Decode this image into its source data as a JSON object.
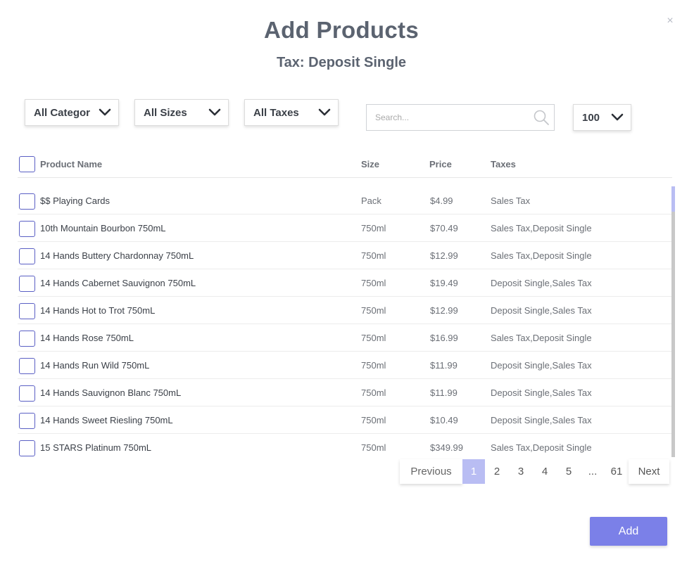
{
  "modal": {
    "title": "Add Products",
    "subtitle": "Tax: Deposit Single",
    "close_label": "×"
  },
  "filters": {
    "category": "All Categor",
    "sizes": "All Sizes",
    "taxes": "All Taxes",
    "page_size": "100"
  },
  "search": {
    "placeholder": "Search...",
    "value": ""
  },
  "table": {
    "headers": {
      "name": "Product Name",
      "size": "Size",
      "price": "Price",
      "taxes": "Taxes"
    },
    "rows": [
      {
        "name": "$$ Playing Cards",
        "size": "Pack",
        "price": "$4.99",
        "taxes": "Sales Tax"
      },
      {
        "name": "10th Mountain Bourbon 750mL",
        "size": "750ml",
        "price": "$70.49",
        "taxes": "Sales Tax,Deposit Single"
      },
      {
        "name": "14 Hands Buttery Chardonnay 750mL",
        "size": "750ml",
        "price": "$12.99",
        "taxes": "Sales Tax,Deposit Single"
      },
      {
        "name": "14 Hands Cabernet Sauvignon 750mL",
        "size": "750ml",
        "price": "$19.49",
        "taxes": "Deposit Single,Sales Tax"
      },
      {
        "name": "14 Hands Hot to Trot 750mL",
        "size": "750ml",
        "price": "$12.99",
        "taxes": "Deposit Single,Sales Tax"
      },
      {
        "name": "14 Hands Rose 750mL",
        "size": "750ml",
        "price": "$16.99",
        "taxes": "Sales Tax,Deposit Single"
      },
      {
        "name": "14 Hands Run Wild 750mL",
        "size": "750ml",
        "price": "$11.99",
        "taxes": "Deposit Single,Sales Tax"
      },
      {
        "name": "14 Hands Sauvignon Blanc 750mL",
        "size": "750ml",
        "price": "$11.99",
        "taxes": "Deposit Single,Sales Tax"
      },
      {
        "name": "14 Hands Sweet Riesling 750mL",
        "size": "750ml",
        "price": "$10.49",
        "taxes": "Deposit Single,Sales Tax"
      },
      {
        "name": "15 STARS Platinum 750mL",
        "size": "750ml",
        "price": "$349.99",
        "taxes": "Sales Tax,Deposit Single"
      }
    ]
  },
  "pagination": {
    "previous": "Previous",
    "pages": [
      "1",
      "2",
      "3",
      "4",
      "5",
      "...",
      "61"
    ],
    "active": "1",
    "next": "Next"
  },
  "actions": {
    "add": "Add"
  },
  "colors": {
    "accent": "#7b80e8",
    "active_page": "#b9bdf3",
    "checkbox_border": "#5a5fc4",
    "title": "#5b6370"
  }
}
